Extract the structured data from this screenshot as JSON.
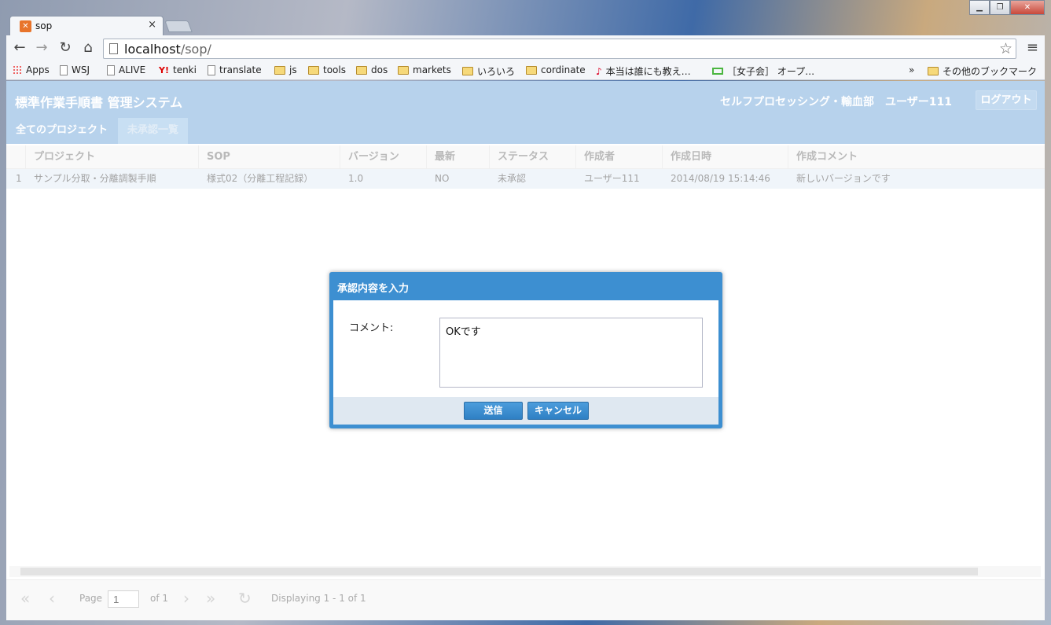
{
  "browser": {
    "tab_title": "sop",
    "tab_close": "×",
    "url_host": "localhost",
    "url_path": "/sop/",
    "window_buttons": [
      "▁",
      "❐",
      "✕"
    ]
  },
  "bookmarks": {
    "items": [
      {
        "label": "Apps",
        "icon": "apps-icon"
      },
      {
        "label": "WSJ",
        "icon": "wsj-icon"
      },
      {
        "label": "ALIVE",
        "icon": "page-icon"
      },
      {
        "label": "tenki",
        "icon": "yahoo-icon"
      },
      {
        "label": "translate",
        "icon": "translate-icon"
      },
      {
        "label": "js",
        "icon": "folder-icon"
      },
      {
        "label": "tools",
        "icon": "folder-icon"
      },
      {
        "label": "dos",
        "icon": "folder-icon"
      },
      {
        "label": "markets",
        "icon": "folder-icon"
      },
      {
        "label": "いろいろ",
        "icon": "folder-icon"
      },
      {
        "label": "cordinate",
        "icon": "folder-icon"
      },
      {
        "label": "本当は誰にも教え…",
        "icon": "music-icon"
      },
      {
        "label": "［女子会］ オープ…",
        "icon": "green-icon"
      }
    ],
    "overflow": "»",
    "other": "その他のブックマーク"
  },
  "app": {
    "title": "標準作業手順書 管理システム",
    "user": "セルフプロセッシング・輸血部　ユーザー111",
    "logout": "ログアウト",
    "tabs": [
      "全てのプロジェクト",
      "未承認一覧"
    ]
  },
  "grid": {
    "columns": [
      "プロジェクト",
      "SOP",
      "バージョン",
      "最新",
      "ステータス",
      "作成者",
      "作成日時",
      "作成コメント"
    ],
    "rows": [
      {
        "num": "1",
        "cells": [
          "サンプル分取・分離調製手順",
          "様式02（分離工程記録）",
          "1.0",
          "NO",
          "未承認",
          "ユーザー111",
          "2014/08/19 15:14:46",
          "新しいバージョンです"
        ]
      }
    ]
  },
  "pager": {
    "page_label": "Page",
    "page_value": "1",
    "of_label": "of 1",
    "displaying": "Displaying 1 - 1 of 1"
  },
  "dialog": {
    "title": "承認内容を入力",
    "comment_label": "コメント:",
    "comment_value": "OKです",
    "submit": "送信",
    "cancel": "キャンセル"
  }
}
